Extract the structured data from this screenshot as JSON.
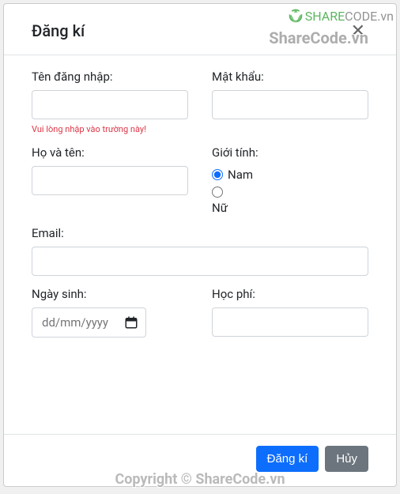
{
  "watermark": {
    "logo_share": "SHARE",
    "logo_code": "CODE",
    "logo_suffix": ".vn",
    "center_text": "ShareCode.vn",
    "bottom_text": "Copyright © ShareCode.vn"
  },
  "modal": {
    "title": "Đăng kí"
  },
  "form": {
    "username": {
      "label": "Tên đăng nhập:",
      "value": "",
      "error": "Vui lòng nhập vào trường này!"
    },
    "password": {
      "label": "Mật khẩu:",
      "value": ""
    },
    "fullname": {
      "label": "Họ và tên:",
      "value": ""
    },
    "gender": {
      "label": "Giới tính:",
      "options": {
        "male": "Nam",
        "female": "Nữ"
      },
      "selected": "male"
    },
    "email": {
      "label": "Email:",
      "value": ""
    },
    "birthdate": {
      "label": "Ngày sinh:",
      "placeholder": "dd/mm/yyyy",
      "value": ""
    },
    "tuition": {
      "label": "Học phí:",
      "value": ""
    }
  },
  "buttons": {
    "submit": "Đăng kí",
    "cancel": "Hủy"
  }
}
